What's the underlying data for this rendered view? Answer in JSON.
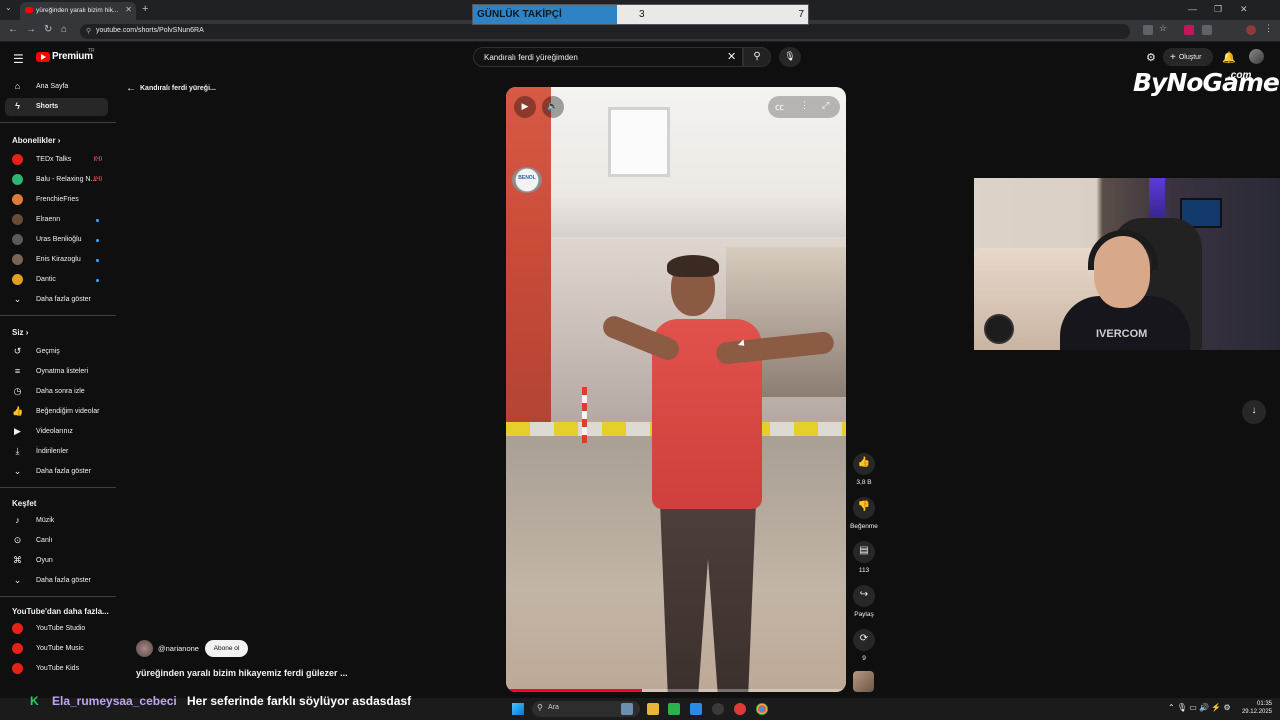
{
  "browser": {
    "tab_title": "yüreğinden yaralı bizim hik...",
    "url": "youtube.com/shorts/PolvSNun6RA"
  },
  "overlay_counter": {
    "label": "GÜNLÜK TAKİPÇİ",
    "current": "3",
    "goal": "7"
  },
  "header": {
    "logo_text": "Premium",
    "logo_region": "TR",
    "search_value": "Kandıralı ferdi yüreğimden",
    "create_label": "Oluştur"
  },
  "sidebar": {
    "main": [
      {
        "label": "Ana Sayfa",
        "icon": "home-icon"
      },
      {
        "label": "Shorts",
        "icon": "shorts-icon",
        "active": true
      }
    ],
    "subscriptions_title": "Abonelikler",
    "subscriptions": [
      {
        "label": "TEDx Talks",
        "color": "#e62117",
        "badge": "live"
      },
      {
        "label": "Balu - Relaxing N...",
        "color": "#2bb673",
        "badge": "live"
      },
      {
        "label": "FrenchieFries",
        "color": "#e07a3a",
        "badge": ""
      },
      {
        "label": "Elraenn",
        "color": "#6b4a3a",
        "badge": "dot"
      },
      {
        "label": "Uras Benlioğlu",
        "color": "#5a5a5a",
        "badge": "dot"
      },
      {
        "label": "Enis Kirazoglu",
        "color": "#7a6555",
        "badge": "dot"
      },
      {
        "label": "Dantic",
        "color": "#e0a020",
        "badge": "dot"
      },
      {
        "label": "Daha fazla göster",
        "icon": "chevron-down-icon"
      }
    ],
    "you_title": "Siz",
    "you": [
      {
        "label": "Geçmiş",
        "icon": "history-icon"
      },
      {
        "label": "Oynatma listeleri",
        "icon": "playlist-icon"
      },
      {
        "label": "Daha sonra izle",
        "icon": "clock-icon"
      },
      {
        "label": "Beğendiğim videolar",
        "icon": "thumbs-up-icon"
      },
      {
        "label": "Videolarınız",
        "icon": "video-icon"
      },
      {
        "label": "İndirilenler",
        "icon": "download-icon"
      },
      {
        "label": "Daha fazla göster",
        "icon": "chevron-down-icon"
      }
    ],
    "explore_title": "Keşfet",
    "explore": [
      {
        "label": "Müzik",
        "icon": "music-icon"
      },
      {
        "label": "Canlı",
        "icon": "live-icon"
      },
      {
        "label": "Oyun",
        "icon": "gamepad-icon"
      },
      {
        "label": "Daha fazla göster",
        "icon": "chevron-down-icon"
      }
    ],
    "more_title": "YouTube'dan daha fazla...",
    "more": [
      {
        "label": "YouTube Studio"
      },
      {
        "label": "YouTube Music"
      },
      {
        "label": "YouTube Kids"
      }
    ]
  },
  "shorts": {
    "back_label": "Kandıralı ferdi yüreği...",
    "storefront_sign": "BENOL",
    "channel_name": "@narianone",
    "subscribe_label": "Abone ol",
    "title": "yüreğinden yaralı bizim hikayemiz ferdi gülezer ...",
    "progress": 0.4,
    "actions": {
      "like_count": "3,8 B",
      "dislike_label": "Beğenme",
      "comments_count": "113",
      "share_label": "Paylaş",
      "remix_count": "9"
    }
  },
  "stream": {
    "brand": "ByNoGame",
    "brand_suffix": ".com",
    "hoodie_text": "IVERCOM",
    "chat_user": "Ela_rumeysaa_cebeci",
    "chat_message": "Her seferinde farklı söylüyor asdasdasf"
  },
  "taskbar": {
    "search_placeholder": "Ara",
    "time": "01:35",
    "date": "29.12.2025"
  }
}
